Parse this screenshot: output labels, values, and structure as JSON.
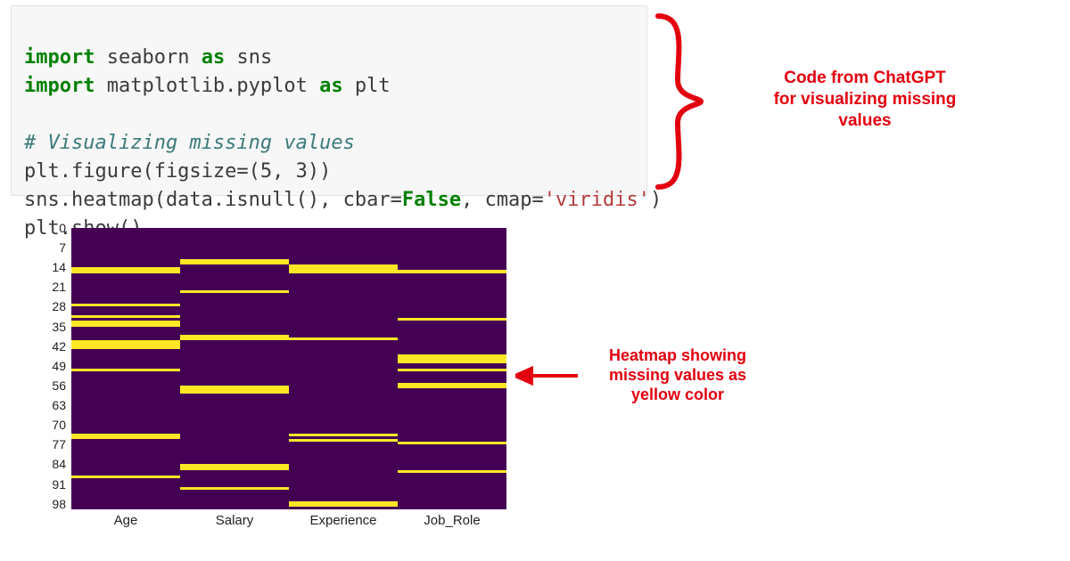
{
  "code": {
    "line1_kw1": "import",
    "line1_rest": " seaborn ",
    "line1_kw2": "as",
    "line1_rest2": " sns",
    "line2_kw1": "import",
    "line2_rest": " matplotlib.pyplot ",
    "line2_kw2": "as",
    "line2_rest2": " plt",
    "line3_blank": " ",
    "line4_comment": "# Visualizing missing values",
    "line5_a": "plt.figure(figsize=(",
    "line5_num1": "5",
    "line5_comma": ", ",
    "line5_num2": "3",
    "line5_b": "))",
    "line6_a": "sns.heatmap(data.isnull(), cbar=",
    "line6_false": "False",
    "line6_b": ", cmap=",
    "line6_str": "'viridis'",
    "line6_c": ")",
    "line7": "plt.show()"
  },
  "annotation1": {
    "line1": "Code from ChatGPT",
    "line2": "for visualizing missing",
    "line3": "values"
  },
  "annotation2": {
    "line1": "Heatmap showing",
    "line2": "missing values as",
    "line3": "yellow color"
  },
  "chart_data": {
    "type": "heatmap",
    "title": "",
    "xlabel": "",
    "ylabel": "",
    "yticks": [
      "0",
      "7",
      "14",
      "21",
      "28",
      "35",
      "42",
      "49",
      "56",
      "63",
      "70",
      "77",
      "84",
      "91",
      "98"
    ],
    "xticks": [
      "Age",
      "Salary",
      "Experience",
      "Job_Role"
    ],
    "ylim": [
      0,
      100
    ],
    "colors": {
      "missing": "#fde725",
      "present": "#440154"
    },
    "missing_rows": {
      "Age": [
        14,
        15,
        27,
        31,
        33,
        34,
        40,
        41,
        42,
        50,
        73,
        74,
        88
      ],
      "Salary": [
        11,
        12,
        22,
        38,
        39,
        56,
        57,
        58,
        84,
        85,
        92
      ],
      "Experience": [
        13,
        14,
        15,
        39,
        73,
        75,
        97,
        98
      ],
      "Job_Role": [
        15,
        32,
        45,
        46,
        47,
        50,
        55,
        56,
        76,
        86
      ]
    }
  }
}
